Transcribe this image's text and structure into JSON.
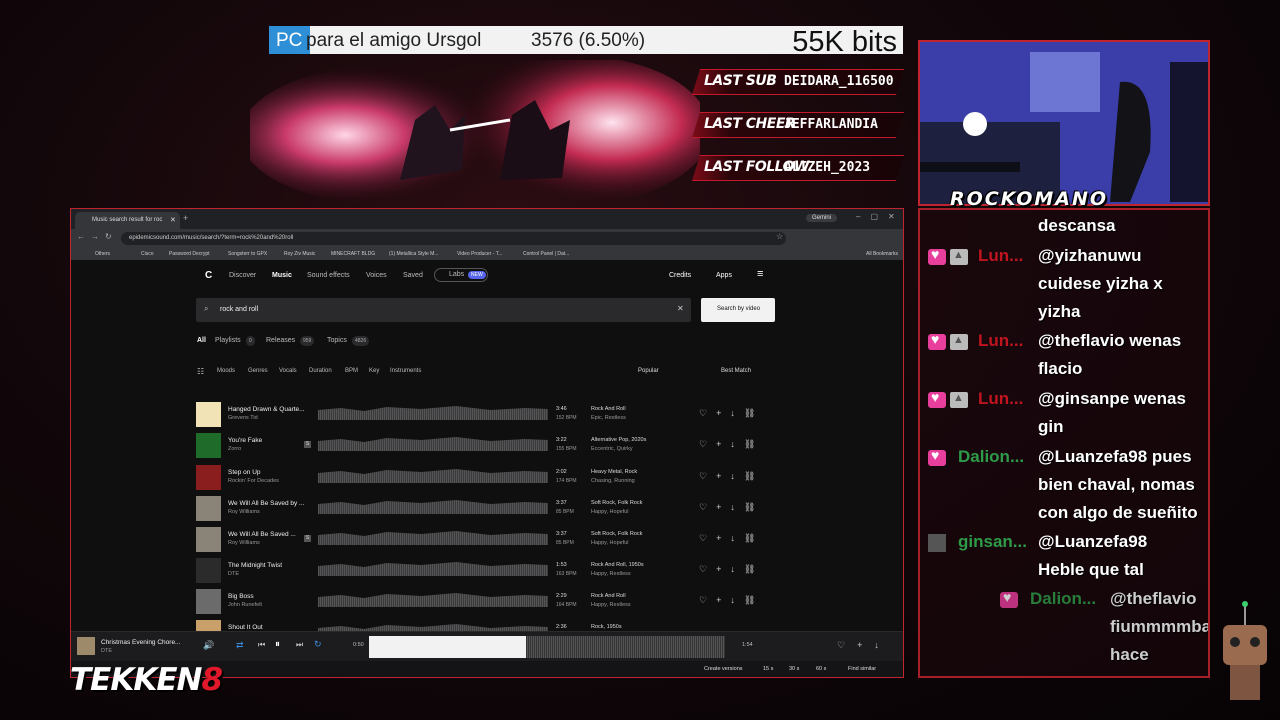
{
  "goal": {
    "prefix": "PC",
    "name": "para el amigo Ursgol",
    "count": "3576 (6.50%)",
    "progress": 0.065,
    "target": "55K bits",
    "fill_color": "#2f8fd6"
  },
  "events": [
    {
      "label": "LAST SUB",
      "value": "DEIDARA_116500"
    },
    {
      "label": "LAST CHEER",
      "value": "JEFFARLANDIA"
    },
    {
      "label": "LAST FOLLOW",
      "value": "ALIZEH_2023"
    }
  ],
  "streamer": {
    "name": "ROCKOMANO"
  },
  "chat": [
    {
      "user": "",
      "badges": [],
      "lines": [
        "descansa"
      ]
    },
    {
      "user": "Lun...",
      "user_color": "#c0151f",
      "badges": [
        "heart-badge",
        "mod-badge"
      ],
      "lines": [
        "@yizhanuwu",
        "cuidese yizha x",
        "yizha"
      ]
    },
    {
      "user": "Lun...",
      "user_color": "#c0151f",
      "badges": [
        "heart-badge",
        "mod-badge"
      ],
      "lines": [
        "@theflavio wenas",
        "flacio"
      ]
    },
    {
      "user": "Lun...",
      "user_color": "#c0151f",
      "badges": [
        "heart-badge",
        "mod-badge"
      ],
      "lines": [
        "@ginsanpe wenas",
        "gin"
      ]
    },
    {
      "user": "Dalion...",
      "user_color": "#2e9b48",
      "badges": [
        "heart-badge"
      ],
      "lines": [
        "@Luanzefa98 pues",
        "bien chaval, nomas",
        "con algo de sueñito"
      ]
    },
    {
      "user": "ginsan...",
      "user_color": "#2e9b48",
      "badges": [
        "avatar-badge"
      ],
      "lines": [
        "@Luanzefa98",
        "Heble que tal"
      ]
    },
    {
      "user": "Dalion...",
      "user_color": "#2e9b48",
      "badges": [
        "heart-badge"
      ],
      "lines": [
        "@theflavio",
        "fiummmmba",
        "hace flaving"
      ]
    }
  ],
  "browser": {
    "tab_title": "Music search result for roc",
    "gemini": "Gemini",
    "url": "epidemicsound.com/music/search/?term=rock%20and%20roll",
    "bookmarks": [
      "Others",
      "Cisco",
      "Password Decrypt",
      "Songsterr to GPX",
      "Roy Ziv Music",
      "MINECRAFT BLDG",
      "(1) Metallica Style M...",
      "Video Producer - T...",
      "Control Panel | Dat...",
      "All Bookmarks"
    ],
    "nav": [
      "Discover",
      "Music",
      "Sound effects",
      "Voices",
      "Saved",
      "Labs"
    ],
    "labs_badge": "NEW",
    "credits": "Credits",
    "apps": "Apps",
    "search_value": "rock and roll",
    "search_by_video": "Search by video",
    "filter_tabs": [
      {
        "label": "All",
        "count": ""
      },
      {
        "label": "Playlists",
        "count": "0"
      },
      {
        "label": "Releases",
        "count": "959"
      },
      {
        "label": "Topics",
        "count": "4826"
      }
    ],
    "filters": [
      "Moods",
      "Genres",
      "Vocals",
      "Duration",
      "BPM",
      "Key",
      "Instruments"
    ],
    "sort_popular": "Popular",
    "sort_match": "Best Match",
    "tracks": [
      {
        "title": "Hanged Drawn & Quarte...",
        "artist": "Grevens Tid",
        "length": "3:46",
        "bpm": "152 BPM",
        "genres": "Rock And Roll",
        "moods": "Epic, Restless",
        "stem": false
      },
      {
        "title": "You're Fake",
        "artist": "Zorro",
        "length": "3:22",
        "bpm": "155 BPM",
        "genres": "Alternative Pop, 2020s",
        "moods": "Eccentric, Quirky",
        "stem": true
      },
      {
        "title": "Step on Up",
        "artist": "Rockin' For Decades",
        "length": "2:02",
        "bpm": "174 BPM",
        "genres": "Heavy Metal, Rock",
        "moods": "Chasing, Running",
        "stem": false
      },
      {
        "title": "We Will All Be Saved by ...",
        "artist": "Roy Williams",
        "length": "3:37",
        "bpm": "85 BPM",
        "genres": "Soft Rock, Folk Rock",
        "moods": "Happy, Hopeful",
        "stem": false
      },
      {
        "title": "We Will All Be Saved ...",
        "artist": "Roy Williams",
        "length": "3:37",
        "bpm": "85 BPM",
        "genres": "Soft Rock, Folk Rock",
        "moods": "Happy, Hopeful",
        "stem": true
      },
      {
        "title": "The Midnight Twist",
        "artist": "DTE",
        "length": "1:53",
        "bpm": "163 BPM",
        "genres": "Rock And Roll, 1950s",
        "moods": "Happy, Restless",
        "stem": false
      },
      {
        "title": "Big Boss",
        "artist": "John Runefelt",
        "length": "2:29",
        "bpm": "164 BPM",
        "genres": "Rock And Roll",
        "moods": "Happy, Restless",
        "stem": false
      },
      {
        "title": "Shout It Out",
        "artist": "",
        "length": "2:36",
        "bpm": "",
        "genres": "Rock, 1950s",
        "moods": "",
        "stem": false
      }
    ],
    "player": {
      "title": "Christmas Evening Chore...",
      "artist": "DTE",
      "elapsed": "0:50",
      "total": "1:54",
      "progress": 0.44
    },
    "footer": {
      "create_versions": "Create versions",
      "durations": [
        "15 s",
        "30 s",
        "60 s"
      ],
      "find_similar": "Find similar"
    }
  },
  "game_logo": {
    "word": "TEKKEN",
    "number": "8"
  }
}
